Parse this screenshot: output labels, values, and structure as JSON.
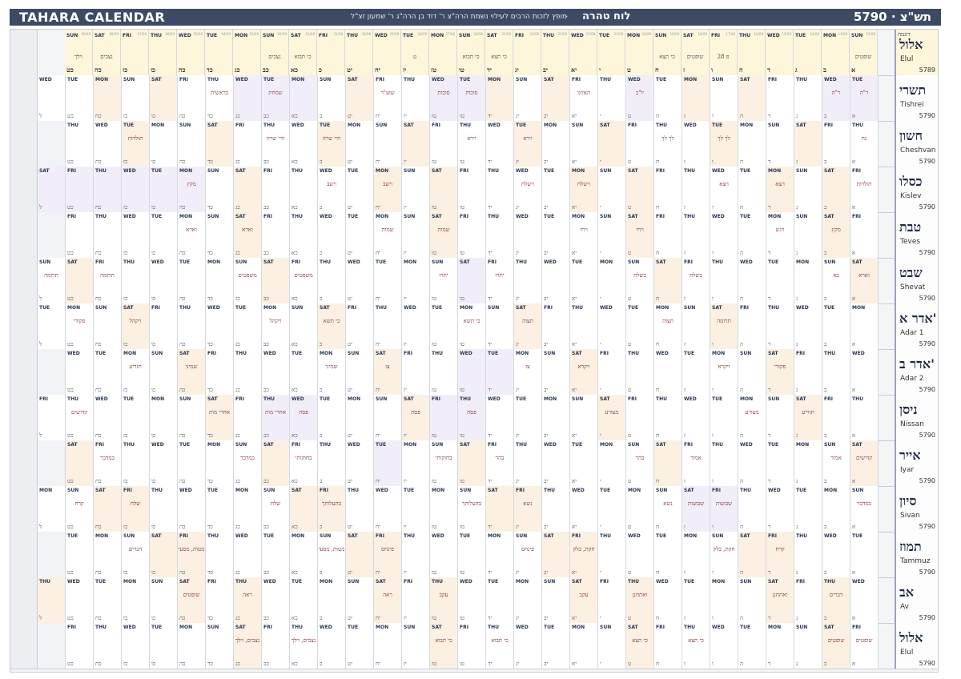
{
  "header": {
    "app_title": "TAHARA CALENDAR",
    "subtitle": "מופץ לזכות הרבים לעילוי נשמת הרה\"צ ר' דוד בן הרה\"ג ר' שמעון זצ\"ל",
    "sep": "·",
    "heb_title": "לוח טהרה",
    "year": "5790  ·  תש\"צ"
  },
  "first_row": {
    "month_heb": "אלול",
    "month_eng": "Elul",
    "year": "5789",
    "tag": "דוגמה",
    "cells": [
      {
        "day": "SUN",
        "date": "12/08",
        "parsha": "שופטים",
        "heb": "א"
      },
      {
        "day": "MON",
        "date": "13/08",
        "parsha": "",
        "heb": "ב"
      },
      {
        "day": "TUE",
        "date": "14/08",
        "parsha": "",
        "heb": "ג"
      },
      {
        "day": "WED",
        "date": "15/08",
        "parsha": "",
        "heb": "ד"
      },
      {
        "day": "THU",
        "date": "16/08",
        "parsha": "",
        "heb": "ה"
      },
      {
        "day": "FRI",
        "date": "17/08",
        "parsha": "28 פ",
        "heb": "ו"
      },
      {
        "day": "SAT",
        "date": "18/08",
        "parsha": "שופטים",
        "heb": "ז"
      },
      {
        "day": "SUN",
        "date": "19/08",
        "parsha": "כי תצא",
        "heb": "ח"
      },
      {
        "day": "MON",
        "date": "20/08",
        "parsha": "",
        "heb": "ט"
      },
      {
        "day": "TUE",
        "date": "21/08",
        "parsha": "",
        "heb": "י"
      },
      {
        "day": "WED",
        "date": "22/08",
        "parsha": "",
        "heb": "יא"
      },
      {
        "day": "THU",
        "date": "23/08",
        "parsha": "",
        "heb": "יב"
      },
      {
        "day": "FRI",
        "date": "24/08",
        "parsha": "",
        "heb": "יג"
      },
      {
        "day": "SAT",
        "date": "25/08",
        "parsha": "כי תצא",
        "heb": "יד"
      },
      {
        "day": "SUN",
        "date": "26/08",
        "parsha": "כי תבוא",
        "heb": "טו"
      },
      {
        "day": "MON",
        "date": "27/08",
        "parsha": "",
        "heb": "טז"
      },
      {
        "day": "TUE",
        "date": "28/08",
        "parsha": "ט",
        "heb": "יז"
      },
      {
        "day": "WED",
        "date": "29/08",
        "parsha": "",
        "heb": "יח"
      },
      {
        "day": "THU",
        "date": "30/08",
        "parsha": "",
        "heb": "יט"
      },
      {
        "day": "FRI",
        "date": "31/08",
        "parsha": "",
        "heb": "כ"
      },
      {
        "day": "SAT",
        "date": "01/09",
        "parsha": "כי תבוא",
        "heb": "כא"
      },
      {
        "day": "SUN",
        "date": "02/09",
        "parsha": "נצבים",
        "heb": "כב"
      },
      {
        "day": "MON",
        "date": "03/09",
        "parsha": "",
        "heb": "כג"
      },
      {
        "day": "TUE",
        "date": "04/09",
        "parsha": "",
        "heb": "כד"
      },
      {
        "day": "WED",
        "date": "05/09",
        "parsha": "",
        "heb": "כה"
      },
      {
        "day": "THU",
        "date": "06/09",
        "parsha": "",
        "heb": "כו"
      },
      {
        "day": "FRI",
        "date": "07/09",
        "parsha": "",
        "heb": "כז"
      },
      {
        "day": "SAT",
        "date": "08/09",
        "parsha": "נצבים",
        "heb": "כח"
      },
      {
        "day": "SUN",
        "date": "09/09",
        "parsha": "וילך",
        "heb": "כט"
      }
    ]
  },
  "months": [
    {
      "heb": "תשרי",
      "eng": "Tishrei",
      "year": "5790",
      "first_day_index": 2,
      "length": 30,
      "parsha": {
        "1": "ר\"ה",
        "2": "ר\"ה",
        "9": "יו\"כ",
        "11": "האזינו",
        "15": "סוכות",
        "16": "סוכות",
        "18": "שוע\"ר",
        "22": "שמחת",
        "24": "בראשית"
      },
      "shaded": {
        "1": "h",
        "2": "h",
        "7": "s",
        "9": "h",
        "14": "s",
        "15": "h",
        "16": "h",
        "21": "h",
        "22": "h",
        "23": "h",
        "28": "s"
      }
    },
    {
      "heb": "חשון",
      "eng": "Cheshvan",
      "year": "5790",
      "first_day_index": 4,
      "length": 29,
      "parsha": {
        "1": "נח",
        "6": "לך לך",
        "8": "לך לך",
        "13": "וירא",
        "15": "וירא",
        "20": "חיי שרה",
        "22": "חיי שרה",
        "27": "תולדות"
      },
      "shaded": {
        "6": "s",
        "13": "s",
        "20": "s",
        "27": "s"
      }
    },
    {
      "heb": "כסלו",
      "eng": "Kislev",
      "year": "5790",
      "first_day_index": 5,
      "length": 30,
      "parsha": {
        "1": "תולדות",
        "4": "ויצא",
        "6": "ויצא",
        "11": "וישלח",
        "13": "וישלח",
        "18": "וישב",
        "20": "וישב",
        "25": "מקץ"
      },
      "shaded": {
        "4": "s",
        "11": "s",
        "18": "s",
        "25": "h",
        "26": "h",
        "27": "h",
        "28": "h",
        "29": "h",
        "30": "h"
      }
    },
    {
      "heb": "טבת",
      "eng": "Teves",
      "year": "5790",
      "first_day_index": 5,
      "length": 29,
      "parsha": {
        "2": "מקץ",
        "4": "ויגש",
        "9": "ויחי",
        "11": "ויחי",
        "16": "שמות",
        "18": "שמות",
        "23": "וארא",
        "25": "וארא"
      },
      "shaded": {
        "2": "s",
        "9": "s",
        "16": "s",
        "23": "s"
      }
    },
    {
      "heb": "שבט",
      "eng": "Shevat",
      "year": "5790",
      "first_day_index": 6,
      "length": 30,
      "parsha": {
        "1": "וארא",
        "2": "בא",
        "7": "בשלח",
        "9": "בשלח",
        "14": "יתרו",
        "16": "יתרו",
        "21": "משפטים",
        "23": "משפטים",
        "28": "תרומה",
        "30": "תרומה"
      },
      "shaded": {
        "1": "s",
        "8": "s",
        "15": "h",
        "22": "s",
        "29": "s"
      }
    },
    {
      "heb": "אדר א'",
      "eng": "Adar 1",
      "year": "5790",
      "first_day_index": 1,
      "length": 30,
      "parsha": {
        "6": "תרומה",
        "8": "תצוה",
        "13": "תצוה",
        "15": "כי תשא",
        "20": "כי תשא",
        "22": "ויקהל",
        "27": "ויקהל",
        "29": "פקודי"
      },
      "shaded": {
        "6": "s",
        "13": "s",
        "20": "s",
        "27": "s"
      }
    },
    {
      "heb": "אדר ב'",
      "eng": "Adar 2",
      "year": "5790",
      "first_day_index": 3,
      "length": 29,
      "parsha": {
        "4": "פקודי",
        "6": "ויקרא",
        "11": "ויקרא",
        "13": "צו",
        "18": "צו",
        "20": "שמיני",
        "25": "שמיני",
        "27": "תזריע"
      },
      "shaded": {
        "4": "s",
        "11": "s",
        "14": "h",
        "15": "h",
        "18": "s",
        "25": "s"
      }
    },
    {
      "heb": "ניסן",
      "eng": "Nissan",
      "year": "5790",
      "first_day_index": 4,
      "length": 30,
      "parsha": {
        "3": "תזריע",
        "5": "מצורע",
        "10": "מצורע",
        "15": "פסח",
        "17": "פסח",
        "21": "פסח",
        "22": "אחרי מות",
        "24": "אחרי מות",
        "29": "קדושים"
      },
      "shaded": {
        "3": "s",
        "10": "s",
        "15": "h",
        "16": "h",
        "17": "s",
        "21": "h",
        "22": "h",
        "24": "s"
      }
    },
    {
      "heb": "אייר",
      "eng": "Iyar",
      "year": "5790",
      "first_day_index": 6,
      "length": 29,
      "parsha": {
        "1": "קדושים",
        "2": "אמור",
        "7": "אמור",
        "9": "בהר",
        "14": "בהר",
        "16": "בחוקותי",
        "21": "בחוקותי",
        "23": "במדבר",
        "28": "במדבר"
      },
      "shaded": {
        "1": "s",
        "8": "s",
        "15": "s",
        "18": "h",
        "22": "s",
        "29": "s"
      }
    },
    {
      "heb": "סיון",
      "eng": "Sivan",
      "year": "5790",
      "first_day_index": 0,
      "length": 30,
      "parsha": {
        "1": "במדבר",
        "6": "שבועות",
        "7": "שבועות",
        "8": "נשא",
        "13": "נשא",
        "15": "בהעלותך",
        "20": "בהעלותך",
        "22": "שלח",
        "27": "שלח",
        "29": "קרח"
      },
      "shaded": {
        "6": "h",
        "7": "h",
        "13": "s",
        "20": "s",
        "27": "s"
      }
    },
    {
      "heb": "תמוז",
      "eng": "Tammuz",
      "year": "5790",
      "first_day_index": 2,
      "length": 29,
      "parsha": {
        "4": "קרח",
        "6": "חקת, בלק",
        "11": "חקת, בלק",
        "13": "פינחס",
        "18": "פינחס",
        "20": "מטות, מסעי",
        "25": "מטות, מסעי",
        "27": "דברים"
      },
      "shaded": {
        "4": "s",
        "11": "s",
        "18": "s",
        "25": "s"
      }
    },
    {
      "heb": "אב",
      "eng": "Av",
      "year": "5790",
      "first_day_index": 3,
      "length": 30,
      "parsha": {
        "2": "דברים",
        "4": "ואתחנן",
        "9": "ואתחנן",
        "11": "עקב",
        "16": "עקב",
        "18": "ראה",
        "23": "ראה",
        "25": "שופטים"
      },
      "shaded": {
        "2": "s",
        "9": "s",
        "16": "s",
        "23": "s",
        "30": "s"
      }
    },
    {
      "heb": "אלול",
      "eng": "Elul",
      "year": "5790",
      "first_day_index": 5,
      "length": 29,
      "parsha": {
        "1": "שופטים",
        "2": "שופטים",
        "7": "כי תצא",
        "9": "כי תצא",
        "14": "כי תבוא",
        "16": "כי תבוא",
        "21": "נצבים, וילך",
        "23": "נצבים, וילך"
      },
      "shaded": {
        "2": "s",
        "9": "s",
        "16": "s",
        "23": "s"
      }
    }
  ],
  "day_names": [
    "SUN",
    "MON",
    "TUE",
    "WED",
    "THU",
    "FRI",
    "SAT"
  ],
  "heb_nums": [
    "א",
    "ב",
    "ג",
    "ד",
    "ה",
    "ו",
    "ז",
    "ח",
    "ט",
    "י",
    "יא",
    "יב",
    "יג",
    "יד",
    "טו",
    "טז",
    "יז",
    "יח",
    "יט",
    "כ",
    "כא",
    "כב",
    "כג",
    "כד",
    "כה",
    "כו",
    "כז",
    "כח",
    "כט",
    "ל"
  ],
  "colors": {
    "shabbos": "#fbf0e2",
    "holiday": "#f2eef9",
    "header": "#3c4a63",
    "example": "#fdf6da"
  }
}
